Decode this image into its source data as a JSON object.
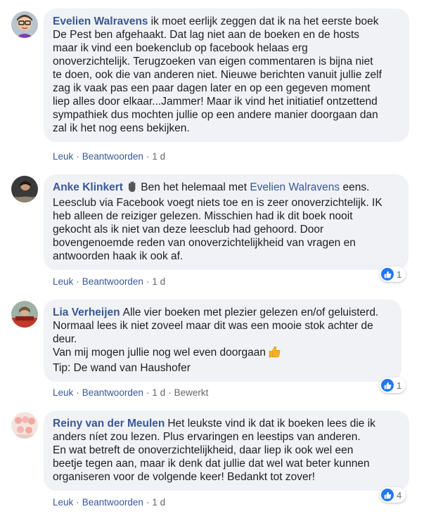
{
  "colors": {
    "bubble_bg": "#f0f2f5",
    "author": "#385898",
    "meta_text": "#65676b",
    "like_blue": "#2078f4"
  },
  "comments": [
    {
      "author": "Evelien Walravens",
      "avatar_icon": "cartoon-avatar-icon",
      "lines": [
        "ik moet eerlijk zeggen dat ik na het eerste boek",
        "De Pest ben afgehaakt. Dat lag niet aan de boeken en de hosts",
        "maar ik vind een boekenclub op facebook helaas erg",
        "onoverzichtelijk. Terugzoeken van eigen commentaren is bijna niet",
        "te doen, ook die van anderen niet. Nieuwe berichten vanuit jullie zelf",
        "zag ik vaak pas een paar dagen later en op een gegeven moment",
        "liep alles door elkaar...Jammer! Maar ik vind het initiatief ontzettend",
        "sympathiek dus mochten jullie op een andere manier doorgaan dan",
        "zal ik het nog eens bekijken."
      ],
      "actions": {
        "like": "Leuk",
        "reply": "Beantwoorden",
        "time": "1 d"
      }
    },
    {
      "author": "Anke Klinkert",
      "badge_icon": "waving-hand-icon",
      "first_line_prefix": "Ben het helemaal met",
      "mention": "Evelien Walravens",
      "first_line_suffix": "eens.",
      "lines": [
        "Leesclub via Facebook voegt niets toe en is zeer onoverzichtelijk. IK",
        "heb alleen de reiziger gelezen. Misschien had ik dit boek nooit",
        "gekocht als ik niet van deze leesclub had gehoord. Door",
        "bovengenoemde reden van onoverzichtelijkheid van vragen en",
        "antwoorden haak ik ook af."
      ],
      "actions": {
        "like": "Leuk",
        "reply": "Beantwoorden",
        "time": "1 d"
      },
      "reaction_count": "1"
    },
    {
      "author": "Lia Verheijen",
      "lines": [
        "Alle vier boeken met plezier gelezen en/of geluisterd.",
        "Normaal lees ik niet zoveel maar dit was een mooie stok achter de",
        "deur.",
        "Van mij mogen jullie nog wel even doorgaan",
        "Tip: De wand van Haushofer"
      ],
      "emoji_icon": "thumbs-up-emoji",
      "actions": {
        "like": "Leuk",
        "reply": "Beantwoorden",
        "time": "1 d",
        "edited": "Bewerkt"
      },
      "reaction_count": "1"
    },
    {
      "author": "Reiny van der Meulen",
      "lines": [
        "Het leukste vind ik dat ik boeken lees die ik",
        "anders níet zou lezen. Plus ervaringen en leestips van anderen.",
        "En wat betreft de onoverzichtelijkheid, daar liep ik ook wel een",
        "beetje tegen aan, maar ik denk dat jullie dat wel wat beter kunnen",
        "organiseren voor de volgende keer! Bedankt tot zover!"
      ],
      "actions": {
        "like": "Leuk",
        "reply": "Beantwoorden",
        "time": "1 d"
      },
      "reaction_count": "4"
    }
  ],
  "separator": "·"
}
